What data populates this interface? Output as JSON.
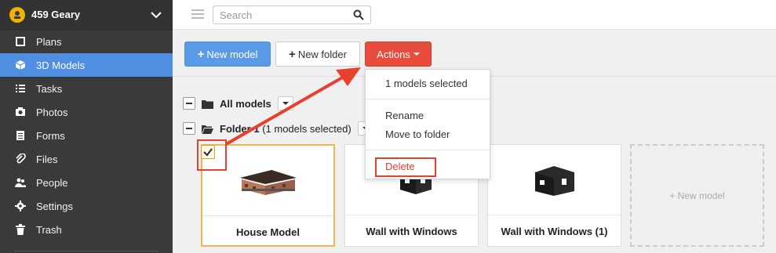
{
  "sidebar": {
    "project_name": "459 Geary",
    "items": [
      {
        "label": "Plans",
        "icon": "plans-icon"
      },
      {
        "label": "3D Models",
        "icon": "cube-icon",
        "active": true
      },
      {
        "label": "Tasks",
        "icon": "list-icon"
      },
      {
        "label": "Photos",
        "icon": "camera-icon"
      },
      {
        "label": "Forms",
        "icon": "document-icon"
      },
      {
        "label": "Files",
        "icon": "paperclip-icon"
      },
      {
        "label": "People",
        "icon": "people-icon"
      },
      {
        "label": "Settings",
        "icon": "gear-icon"
      },
      {
        "label": "Trash",
        "icon": "trash-icon"
      }
    ]
  },
  "topbar": {
    "search_placeholder": "Search"
  },
  "toolbar": {
    "new_model_label": "New model",
    "new_folder_label": "New folder",
    "actions_label": "Actions"
  },
  "tree": {
    "all_models": "All models",
    "folder_name": "Folder 1",
    "folder_meta": "(1 models selected)"
  },
  "cards": [
    {
      "title": "House Model",
      "selected": true
    },
    {
      "title": "Wall with Windows",
      "selected": false
    },
    {
      "title": "Wall with Windows (1)",
      "selected": false
    }
  ],
  "new_model_card": "+ New model",
  "dropdown": {
    "selected_count": "1 models selected",
    "rename": "Rename",
    "move_to_folder": "Move to folder",
    "delete": "Delete"
  },
  "colors": {
    "accent": "#4f8ee0",
    "danger": "#e74c3c",
    "highlight": "#e8402f",
    "selected_border": "#f0b450"
  }
}
